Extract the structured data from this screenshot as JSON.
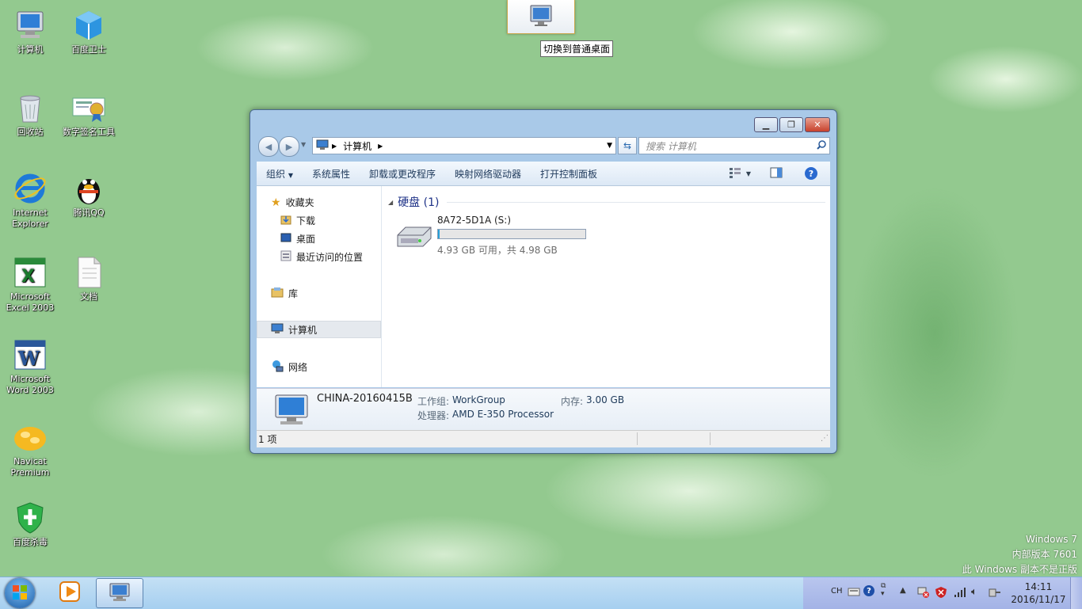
{
  "desktop_icons": [
    {
      "name": "desk-icon-computer",
      "label": "计算机",
      "icon": "computer-icon"
    },
    {
      "name": "desk-icon-baidu-guard",
      "label": "百度卫士",
      "icon": "shield-cube-icon"
    },
    {
      "name": "desk-icon-recycle-bin",
      "label": "回收站",
      "icon": "recycle-bin-icon"
    },
    {
      "name": "desk-icon-sign-tool",
      "label": "数字签名工具",
      "icon": "certificate-icon"
    },
    {
      "name": "desk-icon-ie",
      "label": "Internet Explorer",
      "icon": "ie-icon"
    },
    {
      "name": "desk-icon-qq",
      "label": "腾讯QQ",
      "icon": "penguin-icon"
    },
    {
      "name": "desk-icon-excel",
      "label": "Microsoft Excel 2003",
      "icon": "excel-icon"
    },
    {
      "name": "desk-icon-document",
      "label": "文档",
      "icon": "document-icon"
    },
    {
      "name": "desk-icon-word",
      "label": "Microsoft Word 2003",
      "icon": "word-icon"
    },
    {
      "name": "desk-icon-navicat",
      "label": "Navicat Premium",
      "icon": "navicat-icon"
    },
    {
      "name": "desk-icon-baidu-av",
      "label": "百度杀毒",
      "icon": "antivirus-icon"
    }
  ],
  "switch_desktop": {
    "tooltip": "切换到普通桌面"
  },
  "window": {
    "address_path": "计算机",
    "search_placeholder": "搜索 计算机",
    "toolbar": {
      "organize": "组织",
      "system_properties": "系统属性",
      "uninstall": "卸载或更改程序",
      "map_drive": "映射网络驱动器",
      "control_panel": "打开控制面板"
    },
    "nav": {
      "favorites": "收藏夹",
      "downloads": "下载",
      "desktop": "桌面",
      "recent": "最近访问的位置",
      "libraries": "库",
      "computer": "计算机",
      "network": "网络"
    },
    "section": {
      "title": "硬盘 (1)"
    },
    "drive": {
      "name": "8A72-5D1A (S:)",
      "space": "4.93 GB 可用，共 4.98 GB",
      "used_fraction": 0.01
    },
    "details": {
      "computer_name": "CHINA-20160415B",
      "workgroup_label": "工作组:",
      "workgroup": "WorkGroup",
      "memory_label": "内存:",
      "memory": "3.00 GB",
      "cpu_label": "处理器:",
      "cpu": "AMD E-350 Processor"
    },
    "status": {
      "items": "1 项"
    }
  },
  "watermark": {
    "line1": "Windows 7",
    "line2": "内部版本 7601",
    "line3": "此 Windows 副本不是正版"
  },
  "taskbar": {
    "lang": "CH",
    "time": "14:11",
    "date": "2016/11/17"
  }
}
